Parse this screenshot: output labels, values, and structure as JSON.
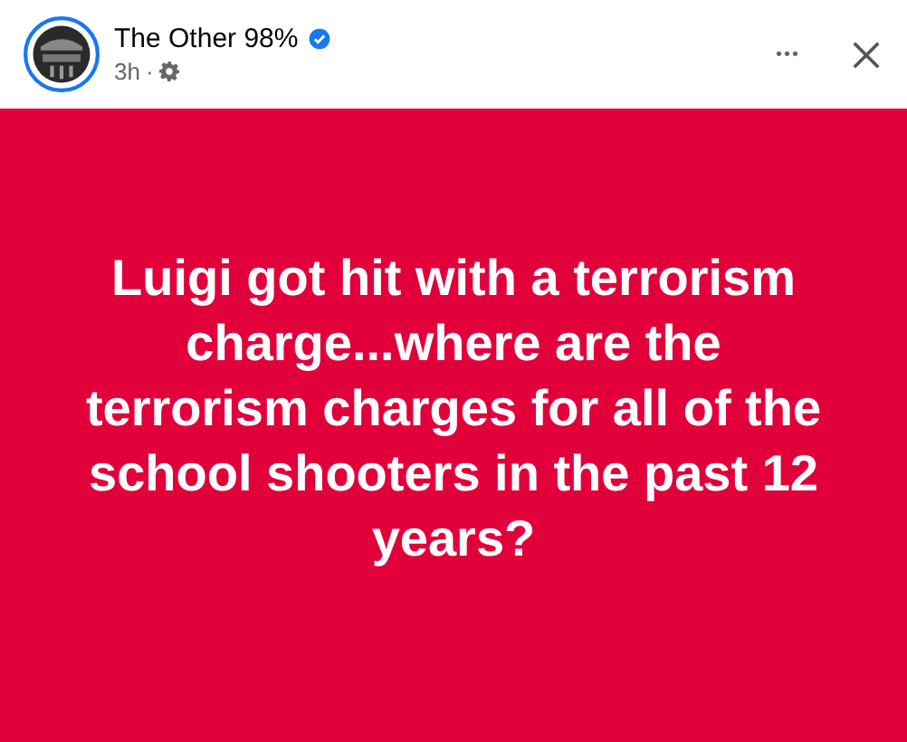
{
  "post": {
    "author": "The Other 98%",
    "verified": true,
    "time": "3h",
    "separator": "·"
  },
  "actions": {
    "more": "•••"
  },
  "body": {
    "text": "Luigi got hit with a terrorism charge...where are the terrorism charges for all of the school shooters in the past 12 years?"
  }
}
